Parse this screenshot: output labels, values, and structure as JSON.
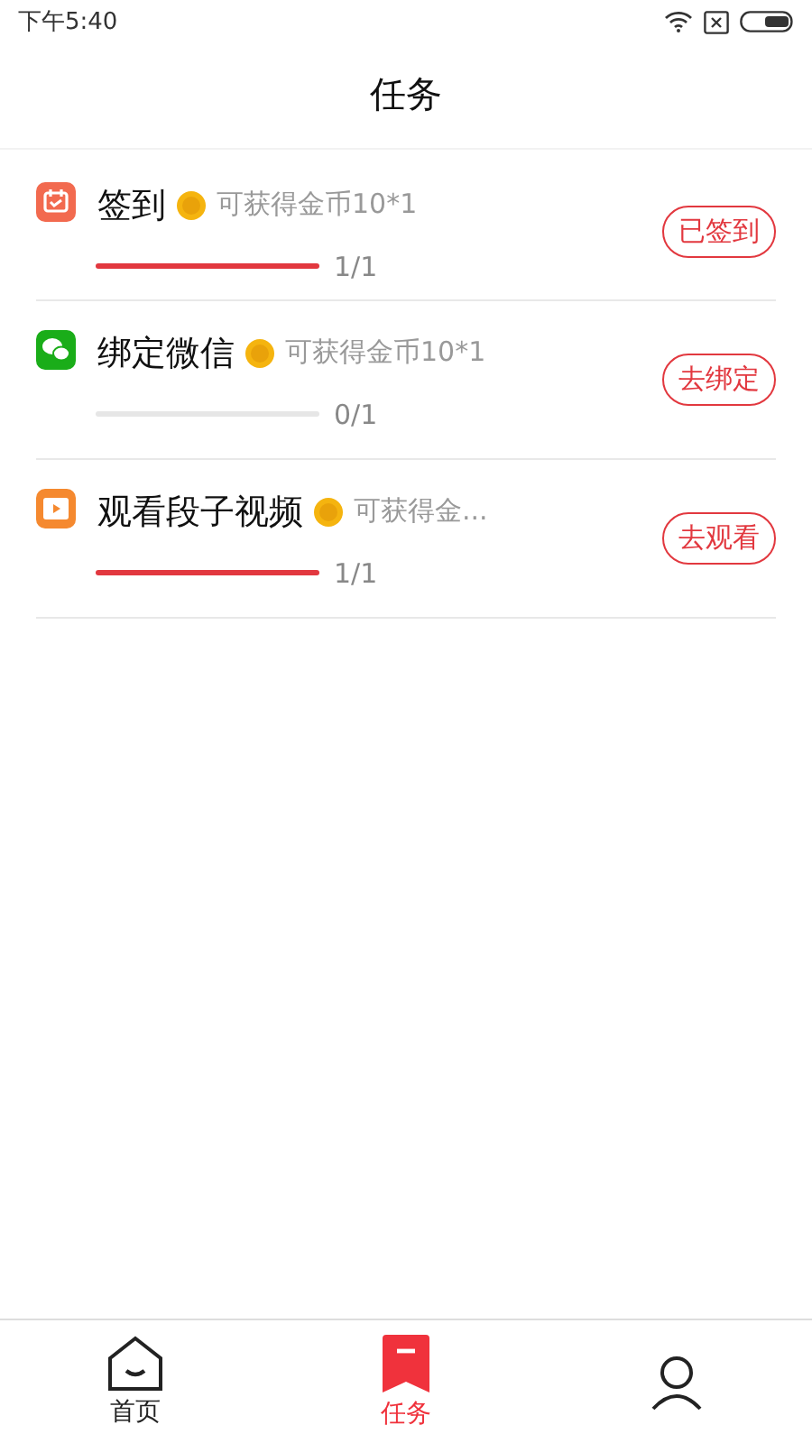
{
  "status_bar": {
    "time": "下午5:40"
  },
  "header": {
    "title": "任务"
  },
  "tasks": [
    {
      "kind": "calendar",
      "title": "签到",
      "reward": "可获得金币10*1",
      "level": 1,
      "progress": "1/1",
      "action": "已签到"
    },
    {
      "kind": "chat",
      "title": "绑定微信",
      "reward": "可获得金币10*1",
      "level": 0,
      "progress": "0/1",
      "action": "去绑定"
    },
    {
      "kind": "video",
      "title": "观看段子视频",
      "reward": "可获得金...",
      "level": 1,
      "progress": "1/1",
      "action": "去观看"
    }
  ],
  "tab_bar": [
    {
      "kind": "home",
      "label": "首页",
      "selected": false
    },
    {
      "kind": "tasks",
      "label": "任务",
      "selected": true
    },
    {
      "kind": "profile",
      "selected": false
    }
  ]
}
